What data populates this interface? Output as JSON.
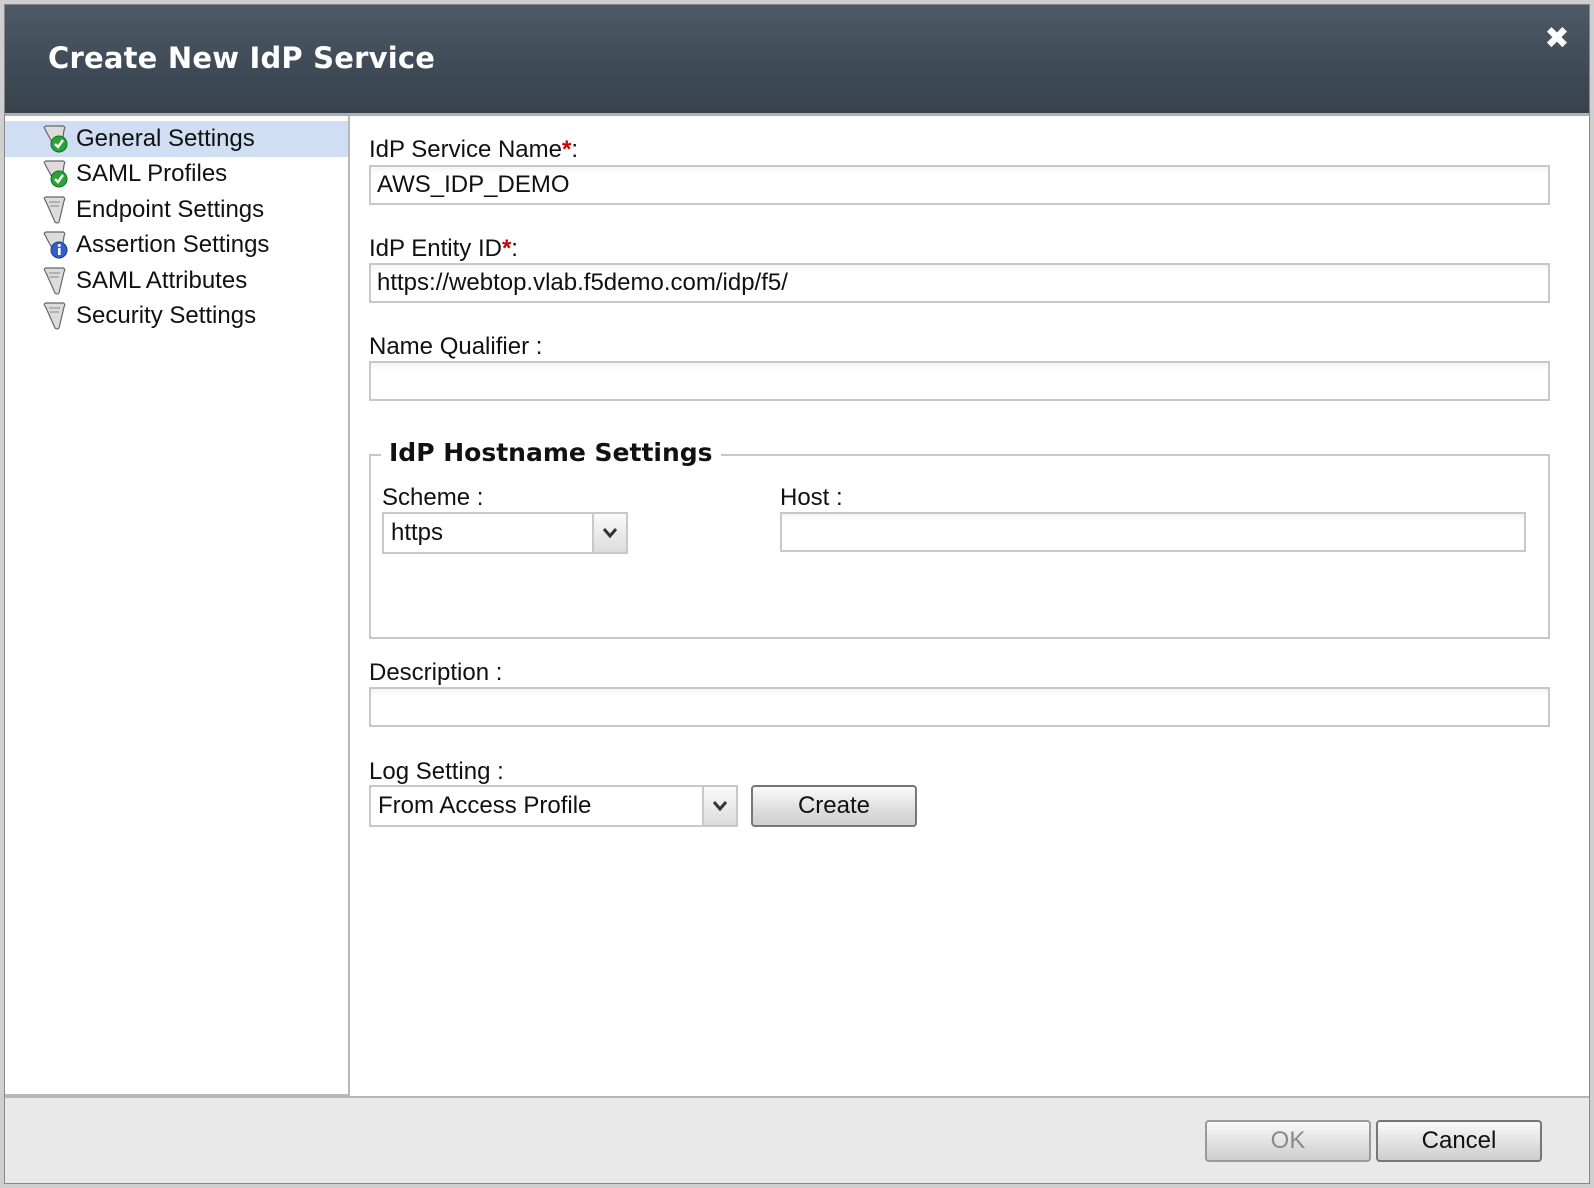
{
  "dialog": {
    "title": "Create New IdP Service",
    "close_symbol": "✖"
  },
  "sidebar": {
    "items": [
      {
        "label": "General Settings",
        "icon": "scroll-check-icon",
        "active": true
      },
      {
        "label": "SAML Profiles",
        "icon": "scroll-check-icon",
        "active": false
      },
      {
        "label": "Endpoint Settings",
        "icon": "scroll-icon",
        "active": false
      },
      {
        "label": "Assertion Settings",
        "icon": "scroll-info-icon",
        "active": false
      },
      {
        "label": "SAML Attributes",
        "icon": "scroll-icon",
        "active": false
      },
      {
        "label": "Security Settings",
        "icon": "scroll-icon",
        "active": false
      }
    ]
  },
  "form": {
    "service_name": {
      "label": "IdP Service Name",
      "required_mark": "*",
      "suffix": ":",
      "value": "AWS_IDP_DEMO"
    },
    "entity_id": {
      "label": "IdP Entity ID",
      "required_mark": "*",
      "suffix": ":",
      "value": "https://webtop.vlab.f5demo.com/idp/f5/"
    },
    "name_qualifier": {
      "label": "Name Qualifier :",
      "value": ""
    },
    "hostname_settings": {
      "legend": "IdP Hostname Settings",
      "scheme": {
        "label": "Scheme :",
        "value": "https"
      },
      "host": {
        "label": "Host :",
        "value": ""
      }
    },
    "description": {
      "label": "Description :",
      "value": ""
    },
    "log_setting": {
      "label": "Log Setting :",
      "value": "From Access Profile",
      "create_label": "Create"
    }
  },
  "footer": {
    "ok_label": "OK",
    "cancel_label": "Cancel"
  },
  "colors": {
    "titlebar": "#3e4a55",
    "active_nav": "#cfdef3",
    "required": "#cc0000"
  }
}
